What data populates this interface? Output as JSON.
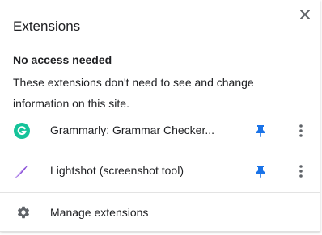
{
  "popup": {
    "title": "Extensions",
    "close_icon": "close-icon"
  },
  "section": {
    "heading": "No access needed",
    "description": "These extensions don't need to see and change information on this site."
  },
  "extensions": [
    {
      "name": "Grammarly: Grammar Checker...",
      "icon": "grammarly-icon",
      "pinned": true,
      "icon_color": "#15c39a"
    },
    {
      "name": "Lightshot (screenshot tool)",
      "icon": "lightshot-icon",
      "pinned": true,
      "icon_color": "#8a4fd8"
    }
  ],
  "footer": {
    "manage_label": "Manage extensions",
    "manage_icon": "gear-icon"
  },
  "colors": {
    "pin_active": "#1a73e8",
    "icon_gray": "#5f6368"
  }
}
